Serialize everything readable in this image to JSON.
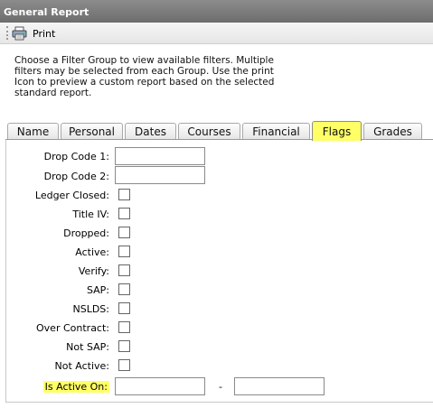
{
  "window": {
    "title": "General Report"
  },
  "toolbar": {
    "print_label": "Print",
    "print_icon": "printer-icon"
  },
  "intro_text": "Choose a Filter Group to view available filters. Multiple filters may be selected from each Group. Use the print Icon to preview a custom report based on the selected standard report.",
  "tabs": [
    {
      "label": "Name",
      "active": false
    },
    {
      "label": "Personal",
      "active": false
    },
    {
      "label": "Dates",
      "active": false
    },
    {
      "label": "Courses",
      "active": false
    },
    {
      "label": "Financial",
      "active": false
    },
    {
      "label": "Flags",
      "active": true
    },
    {
      "label": "Grades",
      "active": false
    }
  ],
  "fields": {
    "drop_code_1": {
      "label": "Drop Code 1:",
      "value": ""
    },
    "drop_code_2": {
      "label": "Drop Code 2:",
      "value": ""
    },
    "ledger_closed": {
      "label": "Ledger Closed:",
      "checked": false
    },
    "title_iv": {
      "label": "Title IV:",
      "checked": false
    },
    "dropped": {
      "label": "Dropped:",
      "checked": false
    },
    "active": {
      "label": "Active:",
      "checked": false
    },
    "verify": {
      "label": "Verify:",
      "checked": false
    },
    "sap": {
      "label": "SAP:",
      "checked": false
    },
    "nslds": {
      "label": "NSLDS:",
      "checked": false
    },
    "over_contract": {
      "label": "Over Contract:",
      "checked": false
    },
    "not_sap": {
      "label": "Not SAP:",
      "checked": false
    },
    "not_active": {
      "label": "Not Active:",
      "checked": false
    },
    "is_active_on": {
      "label": "Is Active On:",
      "from_value": "",
      "separator": "-",
      "to_value": ""
    }
  },
  "colors": {
    "highlight": "#ffff66",
    "titlebar": "#7a7a7a"
  }
}
